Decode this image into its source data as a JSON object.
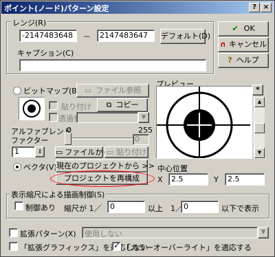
{
  "window": {
    "title": "ポイント(ノード)パターン設定",
    "help_glyph": "?",
    "close_glyph": "×"
  },
  "range": {
    "label": "レンジ(R)",
    "min": "-2147483648",
    "separator": "－",
    "max": "2147483647",
    "default_button": "デフォルト(D)"
  },
  "caption": {
    "label": "キャプション(C)",
    "value": ""
  },
  "buttons": {
    "ok": "OK",
    "cancel": "キャンセル",
    "help": "ヘルプ"
  },
  "bitmap": {
    "label": "ビットマップ(B)",
    "file_ref": "ファイル参照",
    "paste": "貼り付け",
    "copy": "コピー",
    "transparent": "透過色",
    "alpha_label": "アルファブレンド",
    "alpha_min": "0",
    "alpha_max": "255",
    "factor_label": "ファクター",
    "factor_value": "1",
    "alpha_value": "0",
    "from_file": "ファイルから..",
    "paste2": "貼り付け"
  },
  "vector": {
    "label": "ベクタ(V)",
    "from_project": "現在のプロジェクトから >>",
    "rebuild": "プロジェクトを再構成"
  },
  "preview": {
    "label": "プレビュー",
    "zoom_button": "*",
    "center_label": "中心位置",
    "x_label": "X",
    "x_value": "2.5",
    "y_label": "Y",
    "y_value": "2.5"
  },
  "display": {
    "label": "表示縮尺による描画制御(S)",
    "limit_label": "制御あり",
    "scale_label": "縮尺が 1／",
    "scale_from": "0",
    "above_label": "以上　1／",
    "scale_to": "0",
    "below_label": "以下で表示"
  },
  "ext_pattern": {
    "label": "拡張パターン(X)",
    "dropdown": "使用しない"
  },
  "ext_graphics": {
    "label": "「拡張グラフィックス」を適応しない"
  },
  "color_override": {
    "label": "「カラーオーバーライト」を適応する"
  },
  "colors": {
    "title_start": "#0a246a",
    "title_end": "#a6caf0",
    "highlight": "#ff0000"
  }
}
